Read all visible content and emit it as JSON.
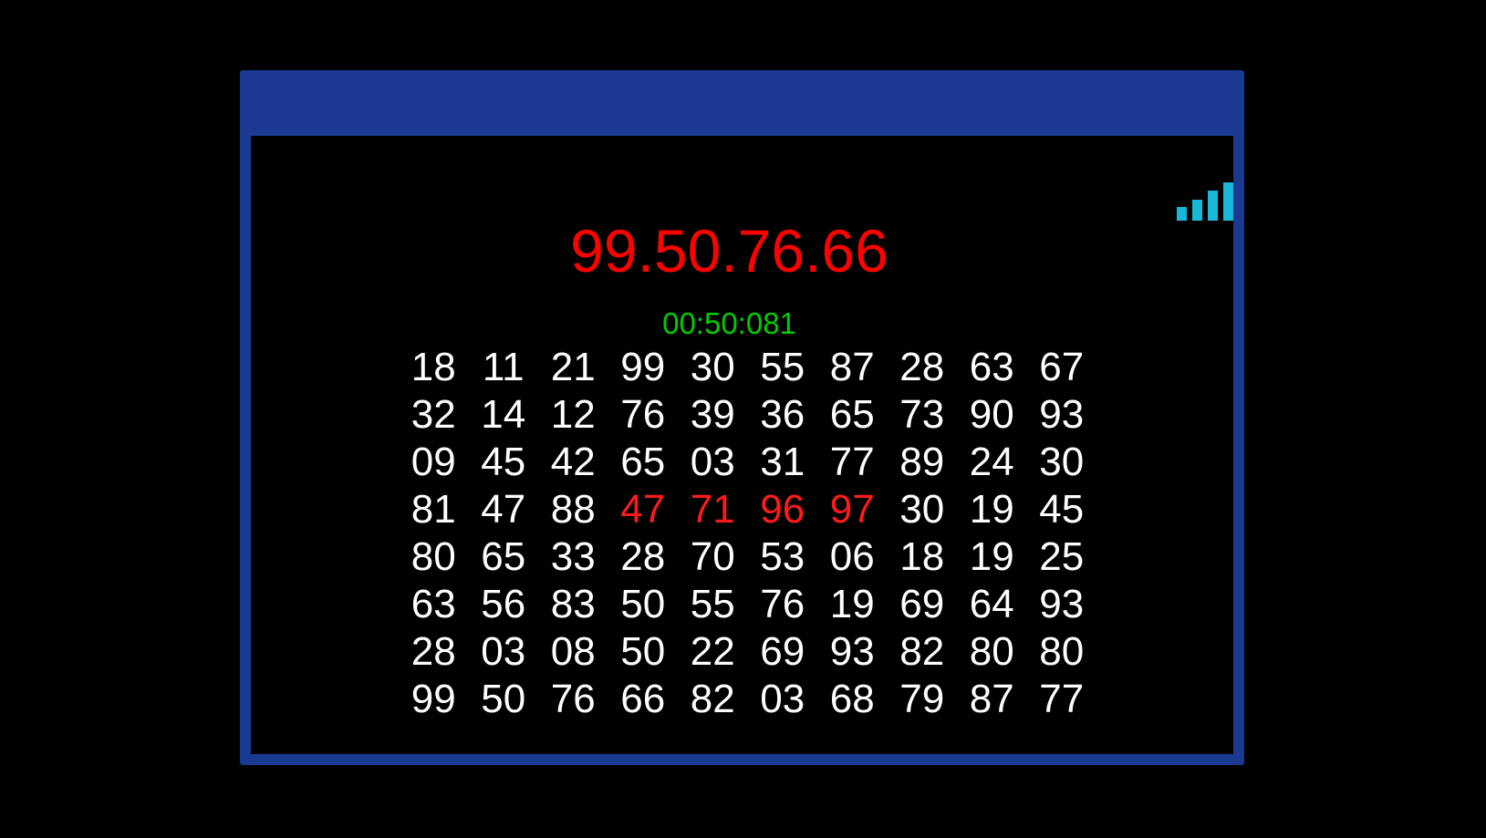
{
  "colors": {
    "frame": "#1a3a92",
    "background": "#000000",
    "target_text": "#ff0000",
    "timer_text": "#00cc00",
    "number_text": "#ffffff",
    "highlight_text": "#ff1a1a",
    "signal": "#1ab8d8"
  },
  "status": {
    "signal_icon": "signal-bars-icon",
    "signal_level": 4
  },
  "game": {
    "target_sequence": "99.50.76.66",
    "timer": "00:50:081",
    "grid": [
      [
        "18",
        "11",
        "21",
        "99",
        "30",
        "55",
        "87",
        "28",
        "63",
        "67"
      ],
      [
        "32",
        "14",
        "12",
        "76",
        "39",
        "36",
        "65",
        "73",
        "90",
        "93"
      ],
      [
        "09",
        "45",
        "42",
        "65",
        "03",
        "31",
        "77",
        "89",
        "24",
        "30"
      ],
      [
        "81",
        "47",
        "88",
        "47",
        "71",
        "96",
        "97",
        "30",
        "19",
        "45"
      ],
      [
        "80",
        "65",
        "33",
        "28",
        "70",
        "53",
        "06",
        "18",
        "19",
        "25"
      ],
      [
        "63",
        "56",
        "83",
        "50",
        "55",
        "76",
        "19",
        "69",
        "64",
        "93"
      ],
      [
        "28",
        "03",
        "08",
        "50",
        "22",
        "69",
        "93",
        "82",
        "80",
        "80"
      ],
      [
        "99",
        "50",
        "76",
        "66",
        "82",
        "03",
        "68",
        "79",
        "87",
        "77"
      ]
    ],
    "highlighted_cells": [
      {
        "row": 3,
        "col": 3
      },
      {
        "row": 3,
        "col": 4
      },
      {
        "row": 3,
        "col": 5
      },
      {
        "row": 3,
        "col": 6
      }
    ]
  }
}
